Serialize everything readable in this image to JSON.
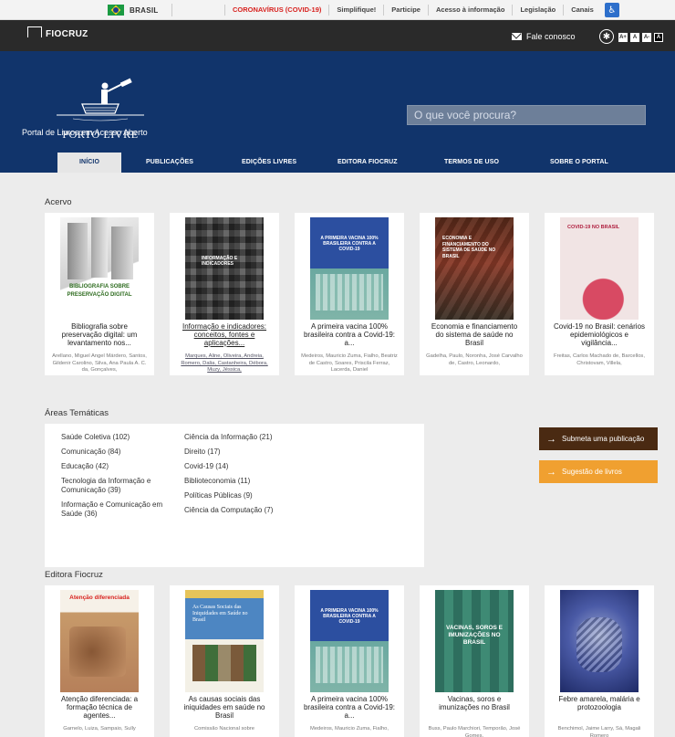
{
  "gov_bar": {
    "country": "BRASIL",
    "links": [
      "CORONAVÍRUS (COVID-19)",
      "Simplifique!",
      "Participe",
      "Acesso à informação",
      "Legislação",
      "Canais"
    ]
  },
  "top_bar": {
    "logo": "FIOCRUZ",
    "contact": "Fale conosco",
    "font_sizes": [
      "A+",
      "A",
      "A-",
      "A"
    ]
  },
  "header": {
    "brand_name": "PORTO LIVRE",
    "tagline": "Portal de Livros em Acesso Aberto",
    "search_placeholder": "O que você procura?"
  },
  "nav": {
    "tabs": [
      "INÍCIO",
      "PUBLICAÇÕES",
      "EDIÇÕES LIVRES",
      "EDITORA FIOCRUZ",
      "TERMOS DE USO",
      "SOBRE O PORTAL"
    ]
  },
  "acervo": {
    "title": "Acervo",
    "books": [
      {
        "title": "Bibliografia sobre preservação digital: um levantamento nos...",
        "authors": "Arellano, Miguel Angel Márdero, Santos, Gildenir Carolino, Silva, Ana Paula A. C. da, Gonçalves,",
        "cover_text": "BIBLIOGRAFIA SOBRE PRESERVAÇÃO DIGITAL"
      },
      {
        "title": "Informação e indicadores: conceitos, fontes e aplicações...",
        "authors": "Marques, Aline, Oliveira, Andreia, Romero, Dalia, Castanheira, Débora, Muzy, Jéssica,",
        "cover_text": "INFORMAÇÃO E INDICADORES"
      },
      {
        "title": "A primeira vacina 100% brasileira contra a Covid-19: a...",
        "authors": "Medeiros, Mauricio Zuma, Fialho, Beatriz de Castro, Soares, Priscila Ferraz, Lacerda, Daniel",
        "cover_text": "A PRIMEIRA VACINA 100% BRASILEIRA CONTRA A COVID-19"
      },
      {
        "title": "Economia e financiamento do sistema de saúde no Brasil",
        "authors": "Gadelha, Paulo, Noronha, José Carvalho de, Castro, Leonardo,",
        "cover_text": "ECONOMIA E FINANCIAMENTO DO SISTEMA DE SAÚDE NO BRASIL"
      },
      {
        "title": "Covid-19 no Brasil: cenários epidemiológicos e vigilância...",
        "authors": "Freitas, Carlos Machado de, Barcellos, Christovam, Villela,",
        "cover_text": "COVID-19 NO BRASIL"
      }
    ]
  },
  "areas": {
    "title": "Áreas Temáticas",
    "col1": [
      "Saúde Coletiva (102)",
      "Comunicação (84)",
      "Educação (42)",
      "Tecnologia da Informação e Comunicação (39)",
      "Informação e Comunicação em Saúde (36)"
    ],
    "col2": [
      "Ciência da Informação (21)",
      "Direito (17)",
      "Covid-19 (14)",
      "Biblioteconomia (11)",
      "Políticas Públicas (9)",
      "Ciência da Computação (7)"
    ]
  },
  "actions": {
    "submit": "Submeta uma publicação",
    "suggest": "Sugestão de livros"
  },
  "editora": {
    "title": "Editora Fiocruz",
    "books": [
      {
        "title": "Atenção diferenciada: a formação técnica de agentes...",
        "authors": "Garnelo, Luiza, Sampaio, Sully",
        "cover_text": "Atenção diferenciada"
      },
      {
        "title": "As causas sociais das iniquidades em saúde no Brasil",
        "authors": "Comissão Nacional sobre",
        "cover_text": "As Causas Sociais das Iniquidades em Saúde no Brasil"
      },
      {
        "title": "A primeira vacina 100% brasileira contra a Covid-19: a...",
        "authors": "Medeiros, Mauricio Zuma, Fialho,",
        "cover_text": "A PRIMEIRA VACINA 100% BRASILEIRA CONTRA A COVID-19"
      },
      {
        "title": "Vacinas, soros e imunizações no Brasil",
        "authors": "Buss, Paulo Marchiori, Temporão, José Gomes,",
        "cover_text": "VACINAS, SOROS E IMUNIZAÇÕES NO BRASIL"
      },
      {
        "title": "Febre amarela, malária e protozoologia",
        "authors": "Benchimol, Jaime Larry, Sá, Magali Romero",
        "cover_text": ""
      }
    ]
  },
  "colors": {
    "header_blue": "#11346b",
    "dark_bar": "#2a2a2a",
    "submit_btn": "#4a2a12",
    "suggest_btn": "#f0a030",
    "covid_red": "#d8221f"
  }
}
